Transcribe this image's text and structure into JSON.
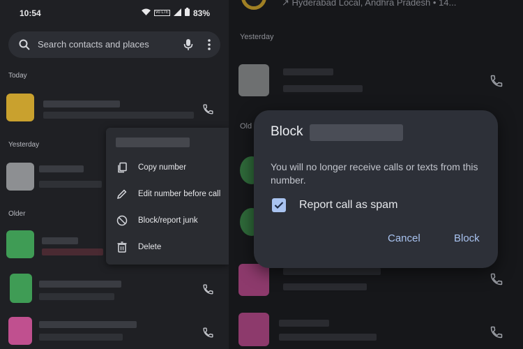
{
  "status_bar": {
    "time": "10:54",
    "battery": "83%",
    "network": "Vo LTE"
  },
  "search": {
    "placeholder": "Search contacts and places",
    "search_icon": "search-icon",
    "mic_icon": "mic-icon",
    "more_icon": "more-vert-icon"
  },
  "left_sections": {
    "today": "Today",
    "yesterday": "Yesterday",
    "older": "Older"
  },
  "context_menu": {
    "items": [
      {
        "label": "Copy number",
        "icon": "copy-icon"
      },
      {
        "label": "Edit number before call",
        "icon": "edit-icon"
      },
      {
        "label": "Block/report junk",
        "icon": "block-icon"
      },
      {
        "label": "Delete",
        "icon": "delete-icon"
      }
    ]
  },
  "right_pane": {
    "top_location": "↗ Hyderabad Local, Andhra Pradesh • 14...",
    "sections": {
      "yesterday": "Yesterday",
      "older": "Old"
    }
  },
  "dialog": {
    "title": "Block",
    "message": "You will no longer receive calls or texts from this number.",
    "checkbox_label": "Report call as spam",
    "checkbox_checked": true,
    "cancel_label": "Cancel",
    "block_label": "Block"
  },
  "colors": {
    "accent": "#a9c3f0",
    "dialog_bg": "#2d3038",
    "left_bg": "#1f2024",
    "right_bg": "#16171a",
    "avatar_yellow": "#c9a12e",
    "avatar_gray": "#8d8f92",
    "avatar_green": "#3f9c55",
    "avatar_pink": "#c0508f"
  }
}
